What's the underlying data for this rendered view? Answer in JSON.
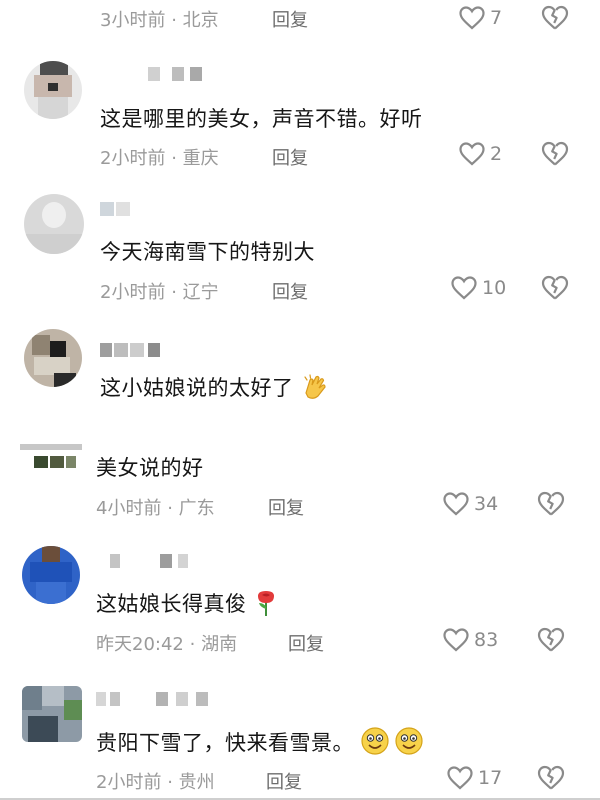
{
  "comments": [
    {
      "text": "",
      "time": "3小时前",
      "location": "北京",
      "reply_label": "回复",
      "likes": "7"
    },
    {
      "text": "这是哪里的美女，声音不错。好听",
      "time": "2小时前",
      "location": "重庆",
      "reply_label": "回复",
      "likes": "2"
    },
    {
      "text": "今天海南雪下的特别大",
      "time": "2小时前",
      "location": "辽宁",
      "reply_label": "回复",
      "likes": "10"
    },
    {
      "text": "这小姑娘说的太好了",
      "emoji": "clapping-hands-icon"
    },
    {
      "text": "美女说的好",
      "time": "4小时前",
      "location": "广东",
      "reply_label": "回复",
      "likes": "34"
    },
    {
      "text": "这姑娘长得真俊",
      "emoji": "rose-icon",
      "time": "昨天20:42",
      "location": "湖南",
      "reply_label": "回复",
      "likes": "83"
    },
    {
      "text": "贵阳下雪了，快来看雪景。",
      "emoji": "smiley-icon",
      "time": "2小时前",
      "location": "贵州",
      "reply_label": "回复",
      "likes": "17"
    }
  ],
  "separator": "·",
  "colors": {
    "meta": "#9a9a9a",
    "text": "#161616",
    "icon": "#8a8a8a"
  }
}
